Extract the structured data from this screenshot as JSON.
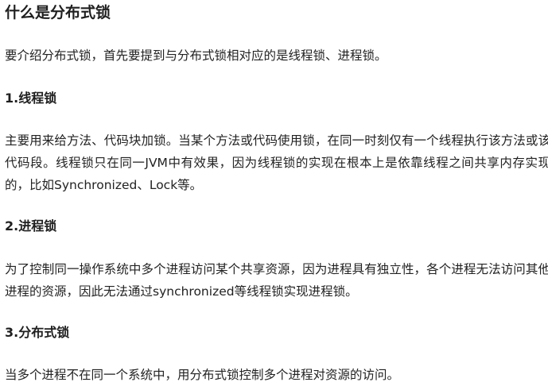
{
  "article": {
    "title": "什么是分布式锁",
    "intro": "要介绍分布式锁，首先要提到与分布式锁相对应的是线程锁、进程锁。",
    "sections": [
      {
        "heading": "1.线程锁",
        "body": "主要用来给方法、代码块加锁。当某个方法或代码使用锁，在同一时刻仅有一个线程执行该方法或该代码段。线程锁只在同一JVM中有效果，因为线程锁的实现在根本上是依靠线程之间共享内存实现的，比如Synchronized、Lock等。"
      },
      {
        "heading": "2.进程锁",
        "body": "为了控制同一操作系统中多个进程访问某个共享资源，因为进程具有独立性，各个进程无法访问其他进程的资源，因此无法通过synchronized等线程锁实现进程锁。"
      },
      {
        "heading": "3.分布式锁",
        "body": "当多个进程不在同一个系统中，用分布式锁控制多个进程对资源的访问。"
      }
    ]
  }
}
